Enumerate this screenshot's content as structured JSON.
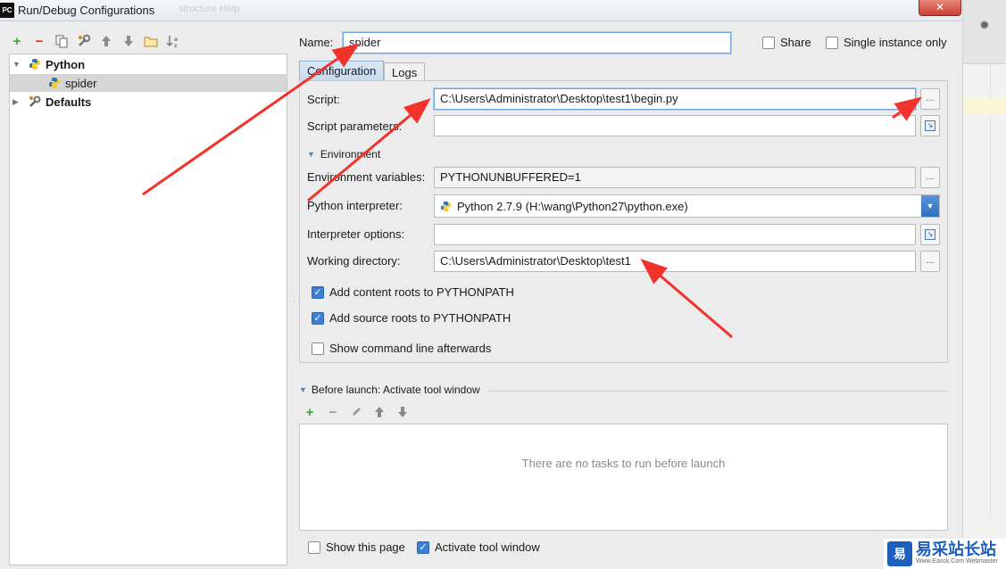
{
  "window": {
    "title": "Run/Debug Configurations",
    "app_icon": "PC",
    "ghost_text": "structure   Help",
    "close_label": "✕"
  },
  "tree": {
    "items": [
      {
        "label": "Python",
        "icon": "python-icon",
        "expanded": true,
        "bold": true
      },
      {
        "label": "spider",
        "icon": "python-icon",
        "selected": true
      },
      {
        "label": "Defaults",
        "icon": "wrench-icon",
        "expanded": false,
        "bold": true
      }
    ]
  },
  "form": {
    "name_label": "Name:",
    "name_value": "spider",
    "share_label": "Share",
    "share_checked": false,
    "single_instance_label": "Single instance only",
    "single_instance_checked": false
  },
  "tabs": [
    {
      "label": "Configuration",
      "active": true
    },
    {
      "label": "Logs",
      "active": false
    }
  ],
  "configuration": {
    "script_label": "Script:",
    "script_value": "C:\\Users\\Administrator\\Desktop\\test1\\begin.py",
    "script_params_label": "Script parameters:",
    "script_params_value": "",
    "environment_label": "Environment",
    "env_vars_label": "Environment variables:",
    "env_vars_value": "PYTHONUNBUFFERED=1",
    "interpreter_label": "Python interpreter:",
    "interpreter_value": "Python 2.7.9 (H:\\wang\\Python27\\python.exe)",
    "interpreter_options_label": "Interpreter options:",
    "interpreter_options_value": "",
    "working_dir_label": "Working directory:",
    "working_dir_value": "C:\\Users\\Administrator\\Desktop\\test1",
    "add_content_roots_label": "Add content roots to PYTHONPATH",
    "add_content_roots_checked": true,
    "add_source_roots_label": "Add source roots to PYTHONPATH",
    "add_source_roots_checked": true,
    "show_cmd_label": "Show command line afterwards",
    "show_cmd_checked": false,
    "browse_label": "..."
  },
  "before_launch": {
    "title": "Before launch: Activate tool window",
    "empty_text": "There are no tasks to run before launch"
  },
  "footer": {
    "show_page_label": "Show this page",
    "show_page_checked": false,
    "activate_tool_label": "Activate tool window",
    "activate_tool_checked": true
  },
  "watermark": {
    "logo": "易",
    "cn_text": "易采站长站",
    "en_text": "Www.Easck.Com Webmaster"
  },
  "colors": {
    "annotation_arrow": "#f2332b",
    "accent": "#3d7fd4",
    "add_green": "#3aa638",
    "remove_red": "#d6393a"
  }
}
